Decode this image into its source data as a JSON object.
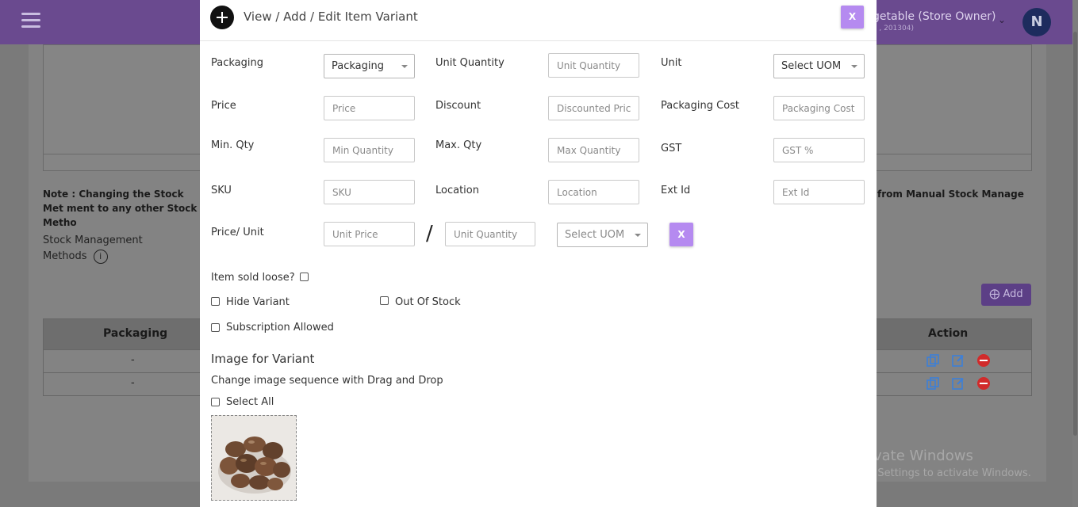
{
  "background": {
    "store_name": "getable (Store Owner)",
    "store_sub": "a , 201304)",
    "avatar_letter": "N",
    "note_left": "Note : Changing the Stock Met ment to any other Stock Metho",
    "note_right": "from Manual Stock Manage",
    "stock_method_label": "Stock Management Methods",
    "info_icon": "i",
    "add_button": "Add",
    "table": {
      "col_packaging": "Packaging",
      "col_action": "Action",
      "rows": [
        "-",
        "-"
      ]
    },
    "watermark_title": "Activate Windows",
    "watermark_sub": "Go to Settings to activate Windows."
  },
  "modal": {
    "title": "View / Add / Edit Item Variant",
    "close_label": "X",
    "fields": {
      "packaging": {
        "label": "Packaging",
        "value": "Packaging"
      },
      "unit_quantity": {
        "label": "Unit Quantity",
        "placeholder": "Unit Quantity"
      },
      "unit": {
        "label": "Unit",
        "value": "Select UOM"
      },
      "price": {
        "label": "Price",
        "placeholder": "Price"
      },
      "discount": {
        "label": "Discount",
        "placeholder": "Discounted Price"
      },
      "packaging_cost": {
        "label": "Packaging Cost",
        "placeholder": "Packaging Cost"
      },
      "min_qty": {
        "label": "Min. Qty",
        "placeholder": "Min Quantity"
      },
      "max_qty": {
        "label": "Max. Qty",
        "placeholder": "Max Quantity"
      },
      "gst": {
        "label": "GST",
        "placeholder": "GST %"
      },
      "sku": {
        "label": "SKU",
        "placeholder": "SKU"
      },
      "location": {
        "label": "Location",
        "placeholder": "Location"
      },
      "ext_id": {
        "label": "Ext Id",
        "placeholder": "Ext Id"
      },
      "price_unit": {
        "label": "Price/ Unit",
        "unit_price_placeholder": "Unit Price",
        "separator": "/",
        "unit_quantity_placeholder": "Unit Quantity",
        "uom": "Select UOM",
        "remove_label": "X"
      }
    },
    "checkboxes": {
      "item_sold_loose": "Item sold loose?",
      "hide_variant": "Hide Variant",
      "out_of_stock": "Out Of Stock",
      "subscription_allowed": "Subscription Allowed",
      "select_all": "Select All"
    },
    "image_section": {
      "title": "Image for Variant",
      "hint": "Change image sequence with Drag and Drop"
    }
  },
  "colors": {
    "accent": "#b58af0",
    "topbar": "#6a4a8f",
    "action_copy": "#3d7fd8",
    "action_delete": "#d12b2b"
  }
}
